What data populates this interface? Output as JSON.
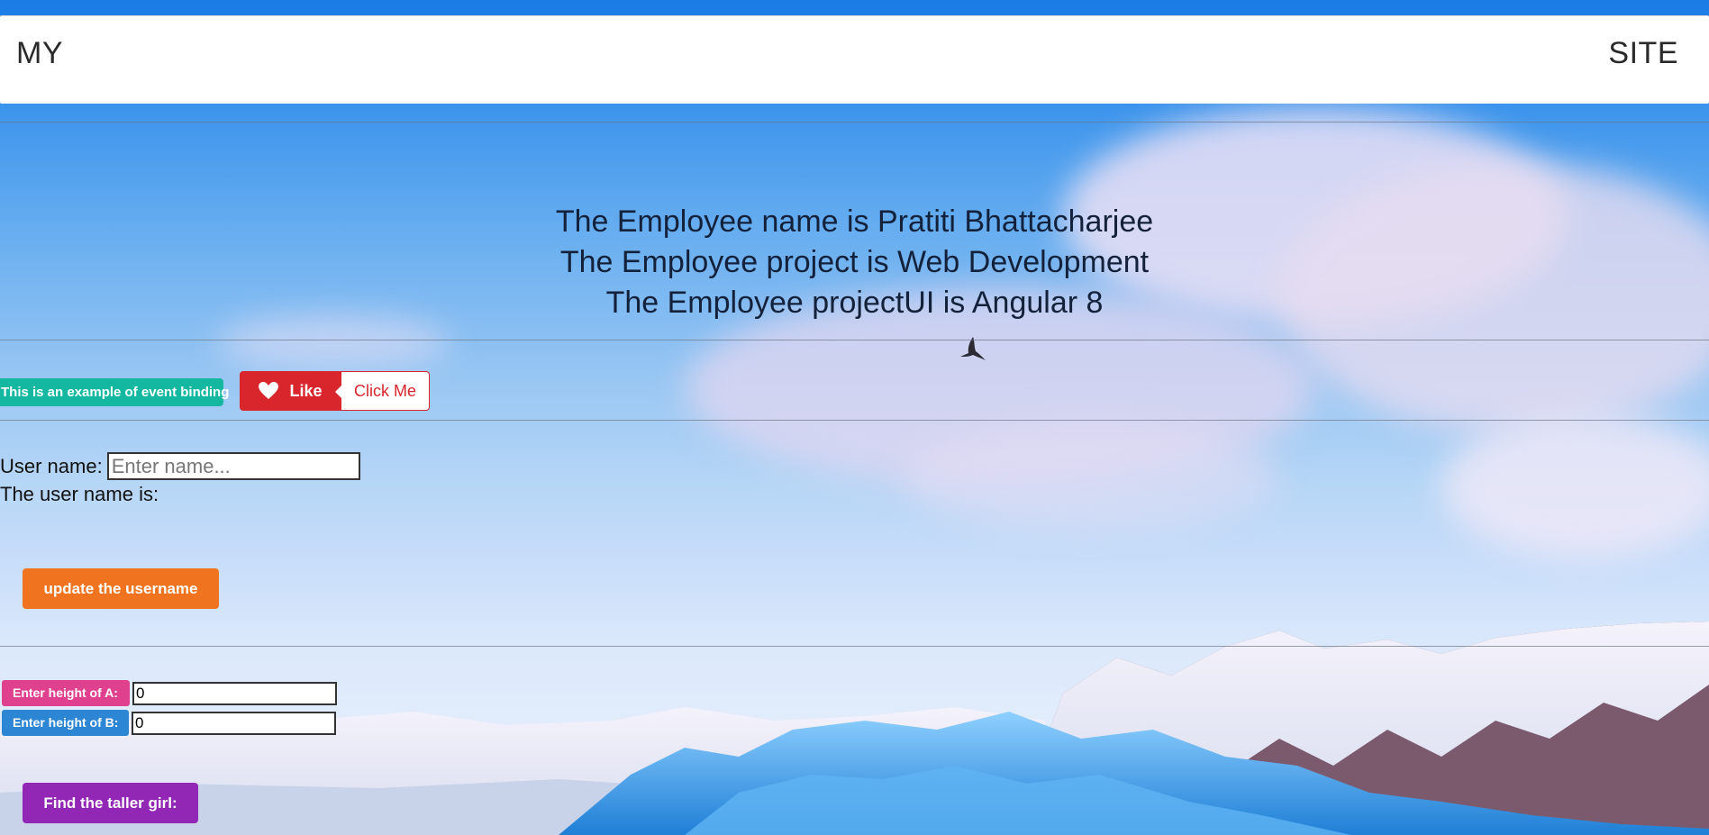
{
  "header": {
    "brand_left": "MY",
    "brand_right": "SITE"
  },
  "employee": {
    "name_line": "The Employee name is Pratiti Bhattacharjee",
    "project_line": "The Employee project is Web Development",
    "project_ui_line": "The Employee projectUI is Angular 8"
  },
  "event_binding": {
    "badge_text": "This is an example of event binding",
    "like_label": "Like",
    "click_label": "Click Me"
  },
  "username": {
    "label": "User name:",
    "placeholder": "Enter name...",
    "value": "",
    "display_label": "The user name is:",
    "update_button": "update the username"
  },
  "heights": {
    "a_label": "Enter height of A:",
    "a_value": "0",
    "b_label": "Enter height of B:",
    "b_value": "0",
    "find_button": "Find the taller girl:"
  },
  "colors": {
    "badge_teal": "#14b8a0",
    "like_red": "#d9262c",
    "update_orange": "#f07420",
    "height_a_pink": "#e0418f",
    "height_b_blue": "#2d86d4",
    "find_purple": "#9227b5"
  },
  "icons": {
    "like": "heart-icon",
    "background": "mountain-landscape"
  }
}
